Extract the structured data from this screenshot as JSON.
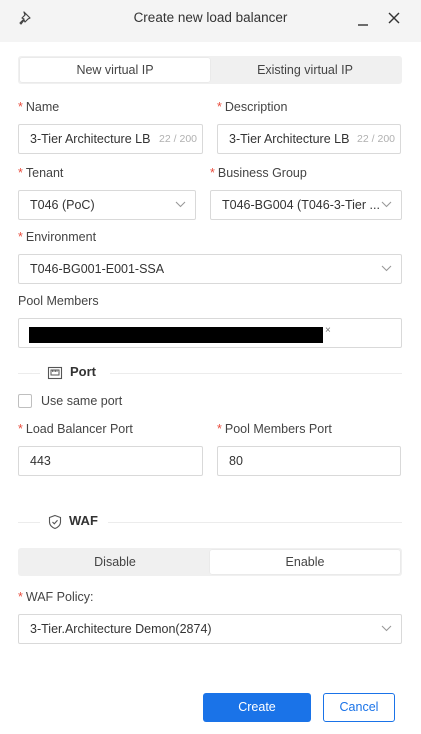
{
  "window": {
    "title": "Create new load balancer",
    "icons": {
      "pin": "pin-icon",
      "minimize": "minimize-icon",
      "close": "close-icon"
    }
  },
  "ip_mode": {
    "options": [
      "New virtual IP",
      "Existing virtual IP"
    ],
    "selected": "New virtual IP"
  },
  "form": {
    "name": {
      "label": "Name",
      "value": "3-Tier Architecture LB",
      "counter": "22 / 200"
    },
    "description": {
      "label": "Description",
      "value": "3-Tier Architecture LB",
      "counter": "22 / 200"
    },
    "tenant": {
      "label": "Tenant",
      "value": "T046 (PoC)"
    },
    "business_group": {
      "label": "Business Group",
      "value": "T046-BG004 (T046-3-Tier ..."
    },
    "environment": {
      "label": "Environment",
      "value": "T046-BG001-E001-SSA"
    },
    "pool_members": {
      "label": "Pool Members",
      "tag_close": "×"
    }
  },
  "port_section": {
    "title": "Port",
    "icon": "network-port-icon",
    "use_same_port": {
      "label": "Use same port",
      "checked": false
    },
    "lb_port": {
      "label": "Load Balancer Port",
      "value": "443"
    },
    "pool_port": {
      "label": "Pool Members Port",
      "value": "80"
    }
  },
  "waf_section": {
    "title": "WAF",
    "icon": "shield-check-icon",
    "options": [
      "Disable",
      "Enable"
    ],
    "selected": "Enable",
    "policy": {
      "label": "WAF Policy:",
      "value": "3-Tier.Architecture Demon(2874)"
    }
  },
  "footer": {
    "create_label": "Create",
    "cancel_label": "Cancel"
  },
  "colors": {
    "accent": "#1a73e8",
    "required": "#e84c3d",
    "header_bg": "#f4f4f4"
  }
}
